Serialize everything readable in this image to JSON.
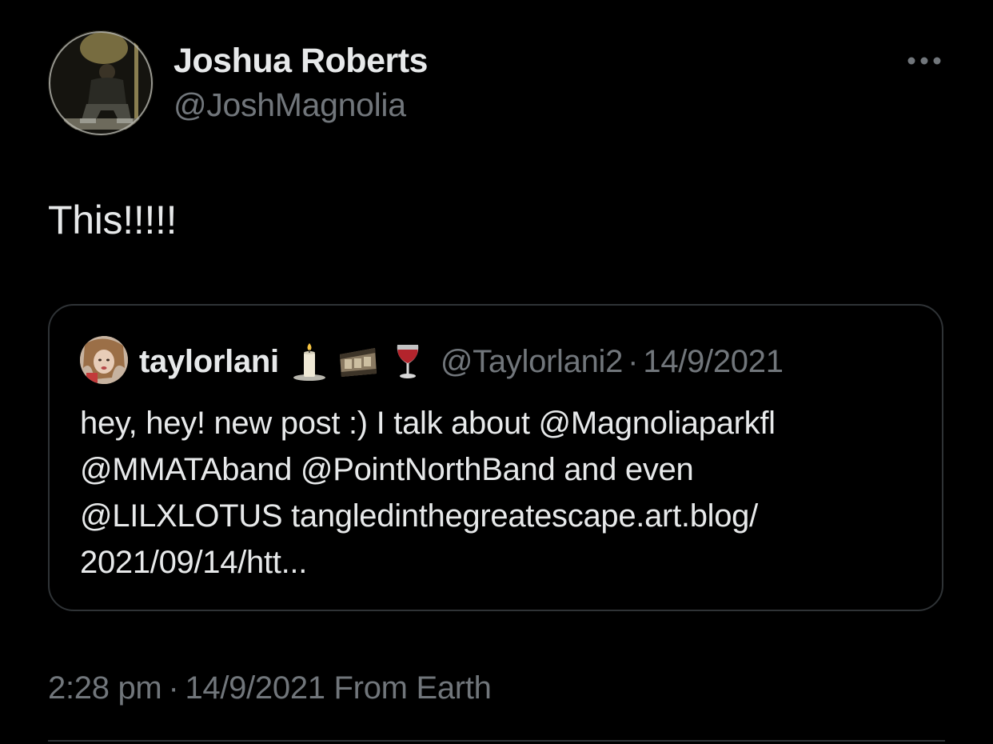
{
  "author": {
    "display_name": "Joshua Roberts",
    "handle": "@JoshMagnolia",
    "avatar_icon": "profile-photo"
  },
  "more_icon": "ellipsis-icon",
  "tweet": {
    "text": "This!!!!!"
  },
  "quoted": {
    "display_name": "taylorlani",
    "emojis": [
      "candle-icon",
      "film-frames-icon",
      "wine-glass-icon"
    ],
    "handle": "@Taylorlani2",
    "separator": "·",
    "date": "14/9/2021",
    "body_lines": [
      "hey, hey! new post :) I talk about @Magnoliaparkfl",
      "@MMATAband @PointNorthBand and even",
      "@LILXLOTUS  tangledinthegreatescape.art.blog/",
      "2021/09/14/htt..."
    ]
  },
  "meta": {
    "time": "2:28 pm",
    "separator": "·",
    "date": "14/9/2021",
    "source": "From Earth"
  },
  "colors": {
    "background": "#000000",
    "primary_text": "#e7e9ea",
    "secondary_text": "#71767b",
    "border": "#2f3336"
  }
}
